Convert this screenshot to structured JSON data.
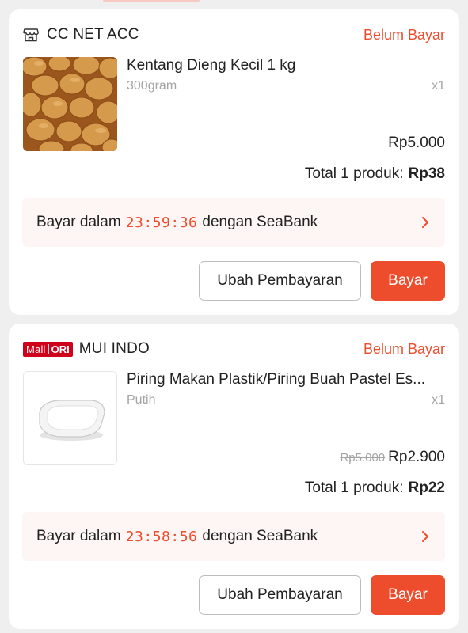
{
  "orders": [
    {
      "shop": {
        "name": "CC NET ACC",
        "icon": "store-icon"
      },
      "status": "Belum Bayar",
      "product": {
        "name": "Kentang Dieng Kecil 1 kg",
        "variant": "300gram",
        "qty": "x1",
        "price": "Rp5.000"
      },
      "total_label": "Total 1 produk:",
      "total_amount": "Rp38",
      "payment": {
        "prefix": "Bayar dalam",
        "timer": "23:59:36",
        "suffix": "dengan SeaBank"
      },
      "buttons": {
        "secondary": "Ubah Pembayaran",
        "primary": "Bayar"
      }
    },
    {
      "shop": {
        "name": "MUI INDO",
        "badge_mall": "Mall",
        "badge_ori": "ORI"
      },
      "status": "Belum Bayar",
      "product": {
        "name": "Piring Makan Plastik/Piring Buah Pastel Es...",
        "variant": "Putih",
        "qty": "x1",
        "price_original": "Rp5.000",
        "price": "Rp2.900"
      },
      "total_label": "Total 1 produk:",
      "total_amount": "Rp22",
      "payment": {
        "prefix": "Bayar dalam",
        "timer": "23:58:56",
        "suffix": "dengan SeaBank"
      },
      "buttons": {
        "secondary": "Ubah Pembayaran",
        "primary": "Bayar"
      }
    }
  ],
  "colors": {
    "accent": "#ee4d2d",
    "mall_badge": "#d0011b",
    "background": "#efefef",
    "pay_bar": "#fef6f5"
  }
}
